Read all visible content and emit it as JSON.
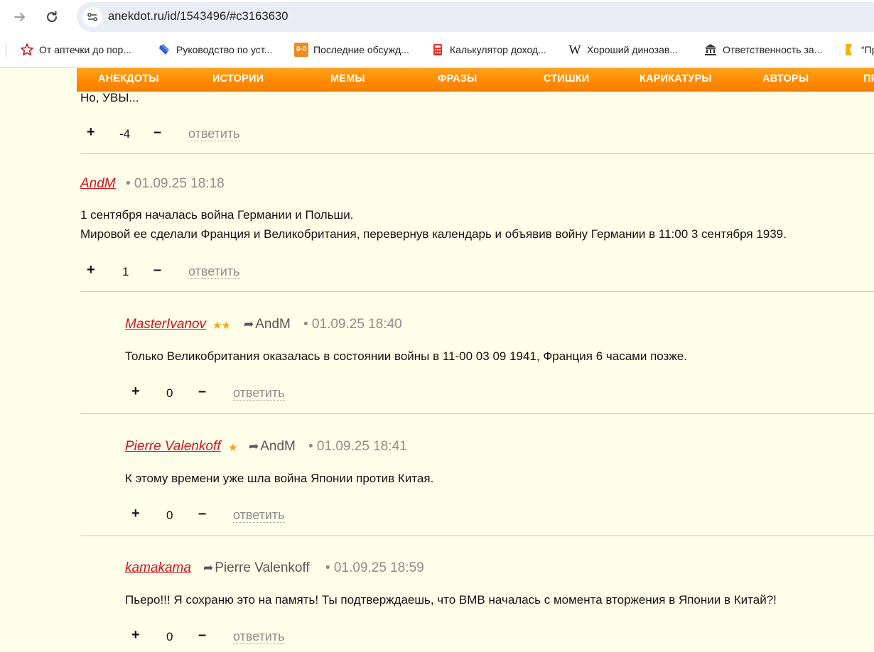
{
  "browser": {
    "url": "anekdot.ru/id/1543496/#c3163630",
    "bookmarks": [
      {
        "label": "От аптечки до пор...",
        "icon": "star-outline-icon"
      },
      {
        "label": "Руководство по уст...",
        "icon": "blue-shield-icon"
      },
      {
        "label": "Последние обсужд...",
        "icon": "orange-score-icon",
        "icon_text": "0-0"
      },
      {
        "label": "Калькулятор доход...",
        "icon": "calculator-icon"
      },
      {
        "label": "Хороший динозав...",
        "icon": "wikipedia-icon",
        "icon_text": "W"
      },
      {
        "label": "Ответственность за...",
        "icon": "institution-icon"
      },
      {
        "label": "“Пр",
        "icon": "yellow-bookmark-icon"
      }
    ]
  },
  "menu": [
    "АНЕКДОТЫ",
    "ИСТОРИИ",
    "МЕМЫ",
    "ФРАЗЫ",
    "СТИШКИ",
    "КАРИКАТУРЫ",
    "АВТОРЫ",
    "ПР"
  ],
  "reply_label": "ответить",
  "comments": [
    {
      "text": [
        "Но, УВЫ..."
      ],
      "votes": {
        "plus": "+",
        "score": "-4",
        "minus": "–"
      }
    },
    {
      "author": "AndM",
      "date": "• 01.09.25 18:18",
      "text": [
        "1 сентября началась война Германии и Польши.",
        "Мировой ее сделали Франция и Великобритания, перевернув календарь и объявив войну Германии в 11:00 3 сентября 1939."
      ],
      "votes": {
        "plus": "+",
        "score": "1",
        "minus": "–"
      }
    },
    {
      "author": "MasterIvanov",
      "stars": "★★",
      "reply_to": "AndM",
      "date": "• 01.09.25 18:40",
      "text": [
        "Только Великобритания оказалась в состоянии войны в 11-00 03 09 1941, Франция 6 часами позже."
      ],
      "votes": {
        "plus": "+",
        "score": "0",
        "minus": "–"
      }
    },
    {
      "author": "Pierre Valenkoff",
      "stars": "★",
      "reply_to": "AndM",
      "date": "• 01.09.25 18:41",
      "text": [
        "К этому времени уже шла война Японии против Китая."
      ],
      "votes": {
        "plus": "+",
        "score": "0",
        "minus": "–"
      }
    },
    {
      "author": "kamakama",
      "reply_to": "Pierre Valenkoff",
      "date": "• 01.09.25 18:59",
      "text": [
        "Пьеро!!! Я сохраню это на память! Ты подтверждаешь, что ВМВ началась с момента вторжения в Японии в Китай?!"
      ],
      "votes": {
        "plus": "+",
        "score": "0",
        "minus": "–"
      }
    }
  ],
  "colors": {
    "menu": "#ff8a00",
    "author": "#d0141e",
    "background": "#ffffe9",
    "star": "#f6a21a"
  }
}
